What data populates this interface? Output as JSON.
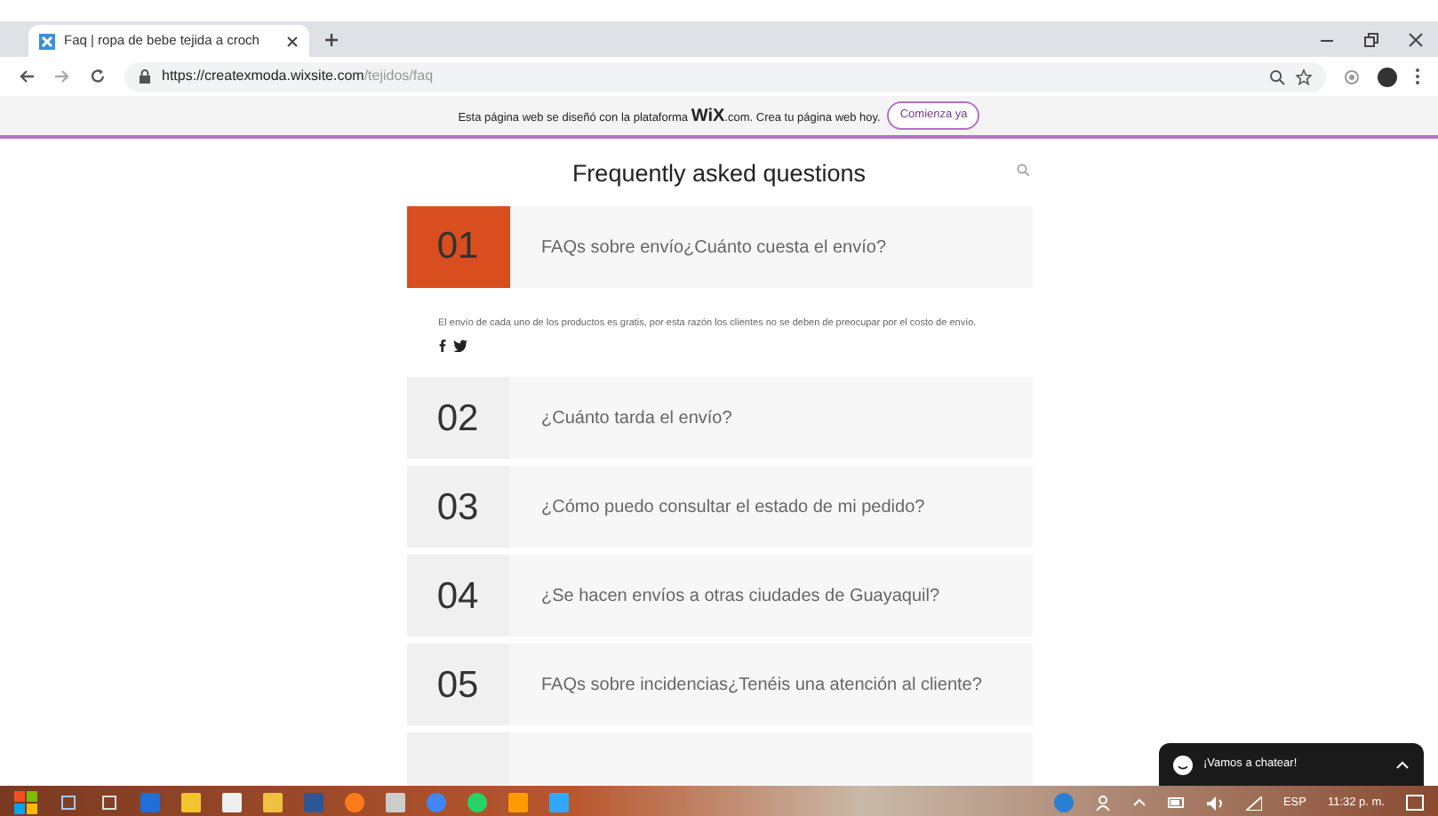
{
  "browser": {
    "tab_title": "Faq | ropa de bebe tejida a croch",
    "url_host": "https://createxmoda.wixsite.com",
    "url_path": "/tejidos/faq"
  },
  "wix_banner": {
    "text": "Esta página web se diseñó con la plataforma **WiX**.com. Crea tu página web hoy.",
    "button": "Comienza ya"
  },
  "faq": {
    "title": "Frequently asked questions",
    "items": [
      {
        "number": "01",
        "question": "FAQs sobre envío¿Cuánto cuesta el envío?",
        "expanded": true,
        "answer": "El envío de cada uno de los productos es gratis, por esta razón los clientes no se deben de preocupar por el costo de envío."
      },
      {
        "number": "02",
        "question": "¿Cuánto tarda el envío?",
        "expanded": false
      },
      {
        "number": "03",
        "question": "¿Cómo puedo consultar el estado de mi pedido?",
        "expanded": false
      },
      {
        "number": "04",
        "question": "¿Se hacen envíos a otras ciudades de Guayaquil?",
        "expanded": false
      },
      {
        "number": "05",
        "question": "FAQs sobre incidencias¿Tenéis una atención al cliente?",
        "expanded": false
      },
      {
        "expanded": false
      }
    ]
  },
  "chat": {
    "label": "¡Vamos a chatear!"
  },
  "taskbar": {
    "language": "ESP",
    "time": "11:32 p. m."
  }
}
